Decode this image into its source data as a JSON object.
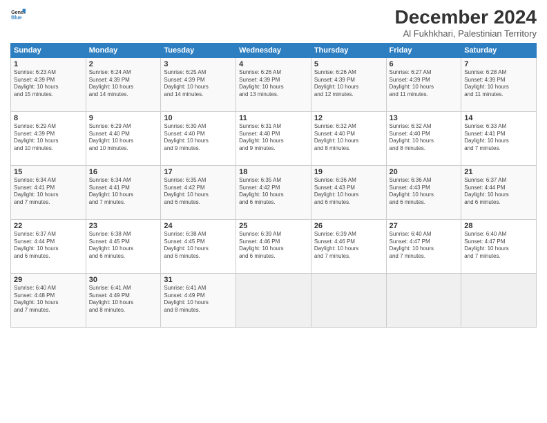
{
  "header": {
    "title": "December 2024",
    "subtitle": "Al Fukhkhari, Palestinian Territory"
  },
  "days": [
    "Sunday",
    "Monday",
    "Tuesday",
    "Wednesday",
    "Thursday",
    "Friday",
    "Saturday"
  ],
  "weeks": [
    [
      {
        "num": "1",
        "info": "Sunrise: 6:23 AM\nSunset: 4:39 PM\nDaylight: 10 hours\nand 15 minutes."
      },
      {
        "num": "2",
        "info": "Sunrise: 6:24 AM\nSunset: 4:39 PM\nDaylight: 10 hours\nand 14 minutes."
      },
      {
        "num": "3",
        "info": "Sunrise: 6:25 AM\nSunset: 4:39 PM\nDaylight: 10 hours\nand 14 minutes."
      },
      {
        "num": "4",
        "info": "Sunrise: 6:26 AM\nSunset: 4:39 PM\nDaylight: 10 hours\nand 13 minutes."
      },
      {
        "num": "5",
        "info": "Sunrise: 6:26 AM\nSunset: 4:39 PM\nDaylight: 10 hours\nand 12 minutes."
      },
      {
        "num": "6",
        "info": "Sunrise: 6:27 AM\nSunset: 4:39 PM\nDaylight: 10 hours\nand 11 minutes."
      },
      {
        "num": "7",
        "info": "Sunrise: 6:28 AM\nSunset: 4:39 PM\nDaylight: 10 hours\nand 11 minutes."
      }
    ],
    [
      {
        "num": "8",
        "info": "Sunrise: 6:29 AM\nSunset: 4:39 PM\nDaylight: 10 hours\nand 10 minutes."
      },
      {
        "num": "9",
        "info": "Sunrise: 6:29 AM\nSunset: 4:40 PM\nDaylight: 10 hours\nand 10 minutes."
      },
      {
        "num": "10",
        "info": "Sunrise: 6:30 AM\nSunset: 4:40 PM\nDaylight: 10 hours\nand 9 minutes."
      },
      {
        "num": "11",
        "info": "Sunrise: 6:31 AM\nSunset: 4:40 PM\nDaylight: 10 hours\nand 9 minutes."
      },
      {
        "num": "12",
        "info": "Sunrise: 6:32 AM\nSunset: 4:40 PM\nDaylight: 10 hours\nand 8 minutes."
      },
      {
        "num": "13",
        "info": "Sunrise: 6:32 AM\nSunset: 4:40 PM\nDaylight: 10 hours\nand 8 minutes."
      },
      {
        "num": "14",
        "info": "Sunrise: 6:33 AM\nSunset: 4:41 PM\nDaylight: 10 hours\nand 7 minutes."
      }
    ],
    [
      {
        "num": "15",
        "info": "Sunrise: 6:34 AM\nSunset: 4:41 PM\nDaylight: 10 hours\nand 7 minutes."
      },
      {
        "num": "16",
        "info": "Sunrise: 6:34 AM\nSunset: 4:41 PM\nDaylight: 10 hours\nand 7 minutes."
      },
      {
        "num": "17",
        "info": "Sunrise: 6:35 AM\nSunset: 4:42 PM\nDaylight: 10 hours\nand 6 minutes."
      },
      {
        "num": "18",
        "info": "Sunrise: 6:35 AM\nSunset: 4:42 PM\nDaylight: 10 hours\nand 6 minutes."
      },
      {
        "num": "19",
        "info": "Sunrise: 6:36 AM\nSunset: 4:43 PM\nDaylight: 10 hours\nand 6 minutes."
      },
      {
        "num": "20",
        "info": "Sunrise: 6:36 AM\nSunset: 4:43 PM\nDaylight: 10 hours\nand 6 minutes."
      },
      {
        "num": "21",
        "info": "Sunrise: 6:37 AM\nSunset: 4:44 PM\nDaylight: 10 hours\nand 6 minutes."
      }
    ],
    [
      {
        "num": "22",
        "info": "Sunrise: 6:37 AM\nSunset: 4:44 PM\nDaylight: 10 hours\nand 6 minutes."
      },
      {
        "num": "23",
        "info": "Sunrise: 6:38 AM\nSunset: 4:45 PM\nDaylight: 10 hours\nand 6 minutes."
      },
      {
        "num": "24",
        "info": "Sunrise: 6:38 AM\nSunset: 4:45 PM\nDaylight: 10 hours\nand 6 minutes."
      },
      {
        "num": "25",
        "info": "Sunrise: 6:39 AM\nSunset: 4:46 PM\nDaylight: 10 hours\nand 6 minutes."
      },
      {
        "num": "26",
        "info": "Sunrise: 6:39 AM\nSunset: 4:46 PM\nDaylight: 10 hours\nand 7 minutes."
      },
      {
        "num": "27",
        "info": "Sunrise: 6:40 AM\nSunset: 4:47 PM\nDaylight: 10 hours\nand 7 minutes."
      },
      {
        "num": "28",
        "info": "Sunrise: 6:40 AM\nSunset: 4:47 PM\nDaylight: 10 hours\nand 7 minutes."
      }
    ],
    [
      {
        "num": "29",
        "info": "Sunrise: 6:40 AM\nSunset: 4:48 PM\nDaylight: 10 hours\nand 7 minutes."
      },
      {
        "num": "30",
        "info": "Sunrise: 6:41 AM\nSunset: 4:49 PM\nDaylight: 10 hours\nand 8 minutes."
      },
      {
        "num": "31",
        "info": "Sunrise: 6:41 AM\nSunset: 4:49 PM\nDaylight: 10 hours\nand 8 minutes."
      },
      null,
      null,
      null,
      null
    ]
  ]
}
